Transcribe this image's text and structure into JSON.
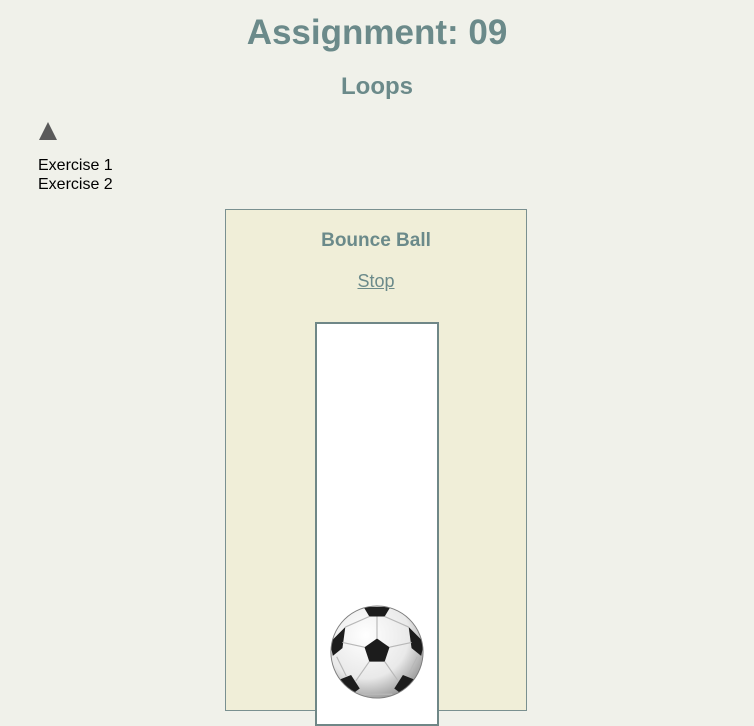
{
  "header": {
    "title": "Assignment: 09",
    "subtitle": "Loops"
  },
  "sidebar": {
    "toggle_icon": "triangle-up-icon",
    "items": [
      {
        "label": "Exercise 1"
      },
      {
        "label": "Exercise 2"
      }
    ]
  },
  "exercise": {
    "title": "Bounce Ball",
    "stop_label": "Stop",
    "ball_icon": "soccer-ball-icon"
  },
  "colors": {
    "background": "#f0f1ea",
    "heading": "#6b8a8a",
    "panel": "#f0eed8",
    "court": "#ffffff",
    "court_border": "#6f8787",
    "toggle": "#5a5a5a"
  }
}
